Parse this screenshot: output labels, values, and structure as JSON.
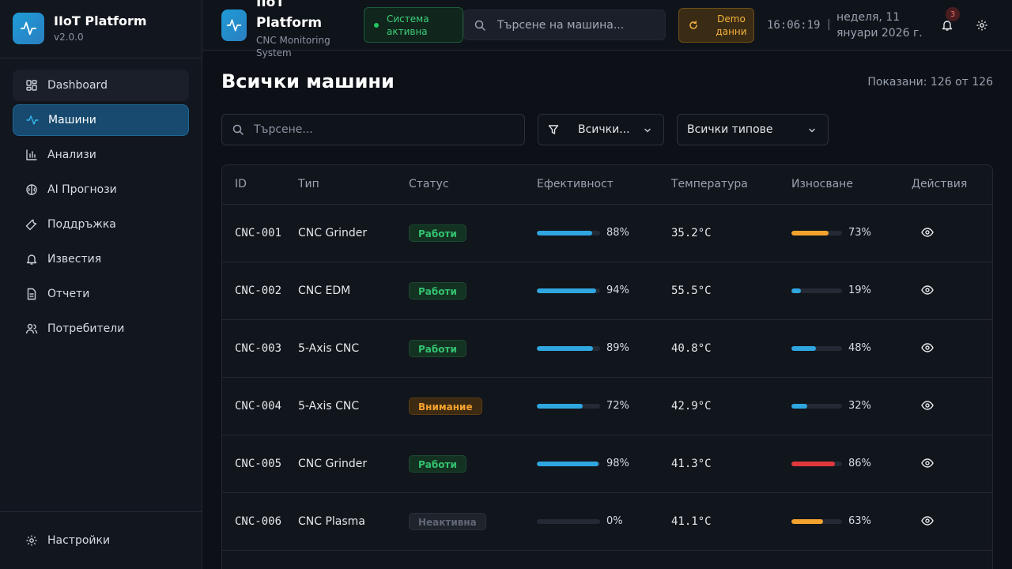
{
  "sidebar": {
    "title": "IIoT Platform",
    "version": "v2.0.0",
    "items": [
      {
        "label": "Dashboard"
      },
      {
        "label": "Машини"
      },
      {
        "label": "Анализи"
      },
      {
        "label": "AI Прогнози"
      },
      {
        "label": "Поддръжка"
      },
      {
        "label": "Известия"
      },
      {
        "label": "Отчети"
      },
      {
        "label": "Потребители"
      }
    ],
    "settings_label": "Настройки"
  },
  "header": {
    "title": "IIoT Platform",
    "subtitle": "CNC Monitoring System",
    "system_status": "Система активна",
    "search_placeholder": "Търсене на машина...",
    "demo_label": "Demo данни",
    "time": "16:06:19",
    "separator": "|",
    "date": "неделя, 11 януари 2026 г.",
    "notifications_count": "3"
  },
  "main": {
    "title": "Всички машини",
    "shown": "Показани: 126 от 126",
    "search_placeholder": "Търсене...",
    "status_filter": "Всички...",
    "type_filter": "Всички типове",
    "columns": [
      "ID",
      "Тип",
      "Статус",
      "Ефективност",
      "Температура",
      "Износване",
      "Действия"
    ],
    "rows": [
      {
        "id": "CNC-001",
        "type": "CNC Grinder",
        "status": "Работи",
        "status_kind": "ok",
        "efficiency": 88,
        "efficiency_label": "88%",
        "temperature": "35.2°C",
        "wear": 73,
        "wear_label": "73%",
        "wear_color": "#f3a22e"
      },
      {
        "id": "CNC-002",
        "type": "CNC EDM",
        "status": "Работи",
        "status_kind": "ok",
        "efficiency": 94,
        "efficiency_label": "94%",
        "temperature": "55.5°C",
        "wear": 19,
        "wear_label": "19%",
        "wear_color": "#2fa6e0"
      },
      {
        "id": "CNC-003",
        "type": "5-Axis CNC",
        "status": "Работи",
        "status_kind": "ok",
        "efficiency": 89,
        "efficiency_label": "89%",
        "temperature": "40.8°C",
        "wear": 48,
        "wear_label": "48%",
        "wear_color": "#2fa6e0"
      },
      {
        "id": "CNC-004",
        "type": "5-Axis CNC",
        "status": "Внимание",
        "status_kind": "warn",
        "efficiency": 72,
        "efficiency_label": "72%",
        "temperature": "42.9°C",
        "wear": 32,
        "wear_label": "32%",
        "wear_color": "#2fa6e0"
      },
      {
        "id": "CNC-005",
        "type": "CNC Grinder",
        "status": "Работи",
        "status_kind": "ok",
        "efficiency": 98,
        "efficiency_label": "98%",
        "temperature": "41.3°C",
        "wear": 86,
        "wear_label": "86%",
        "wear_color": "#e0393b"
      },
      {
        "id": "CNC-006",
        "type": "CNC Plasma",
        "status": "Неактивна",
        "status_kind": "off",
        "efficiency": 0,
        "efficiency_label": "0%",
        "temperature": "41.1°C",
        "wear": 63,
        "wear_label": "63%",
        "wear_color": "#f3a22e"
      }
    ]
  },
  "colors": {
    "accent": "#2fa6e0",
    "ok": "#33c26f",
    "warn": "#f3a22e",
    "danger": "#e0393b"
  }
}
